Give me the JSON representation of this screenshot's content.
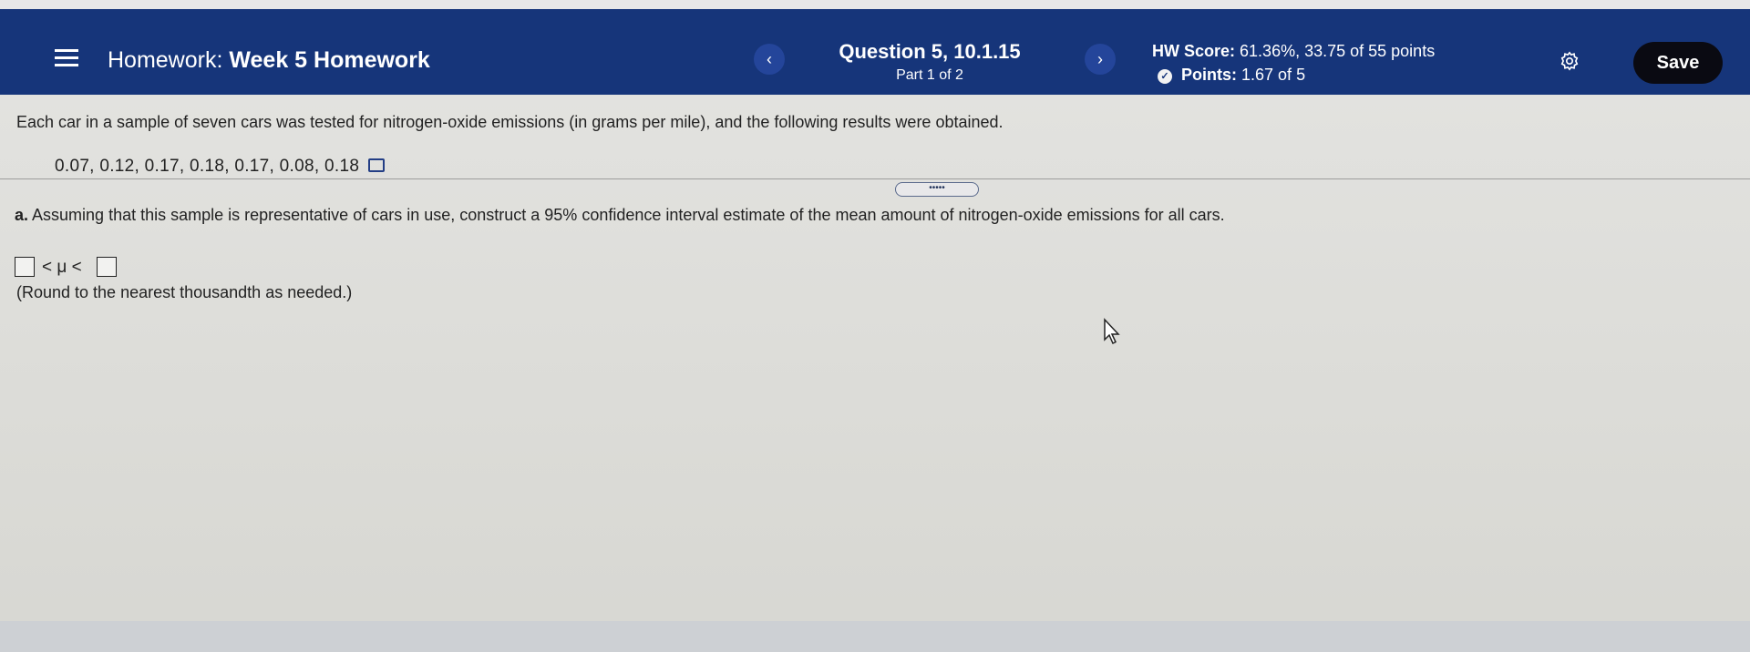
{
  "header": {
    "homework_prefix": "Homework:",
    "homework_name": "Week 5 Homework",
    "question_title": "Question 5, 10.1.15",
    "part": "Part 1 of 2",
    "hw_score_label": "HW Score:",
    "hw_score_value": "61.36%, 33.75 of 55 points",
    "points_label": "Points:",
    "points_value": "1.67 of 5",
    "save_label": "Save",
    "prev_glyph": "‹",
    "next_glyph": "›"
  },
  "question": {
    "problem_text": "Each car in a sample of seven cars was tested for nitrogen-oxide emissions (in grams per mile), and the following results were obtained.",
    "data_values": "0.07, 0.12, 0.17, 0.18, 0.17, 0.08, 0.18",
    "expand_label": "•••••",
    "part_a_label": "a.",
    "part_a_text": "Assuming that this sample is representative of cars in use, construct a 95% confidence interval estimate of the mean amount of nitrogen-oxide emissions for all cars.",
    "interval_middle": "< μ <",
    "round_note": "(Round to the nearest thousandth as needed.)"
  },
  "colors": {
    "header_bg": "#16357a",
    "save_bg": "#0a0a12",
    "page_bg": "#dcdcd8"
  }
}
